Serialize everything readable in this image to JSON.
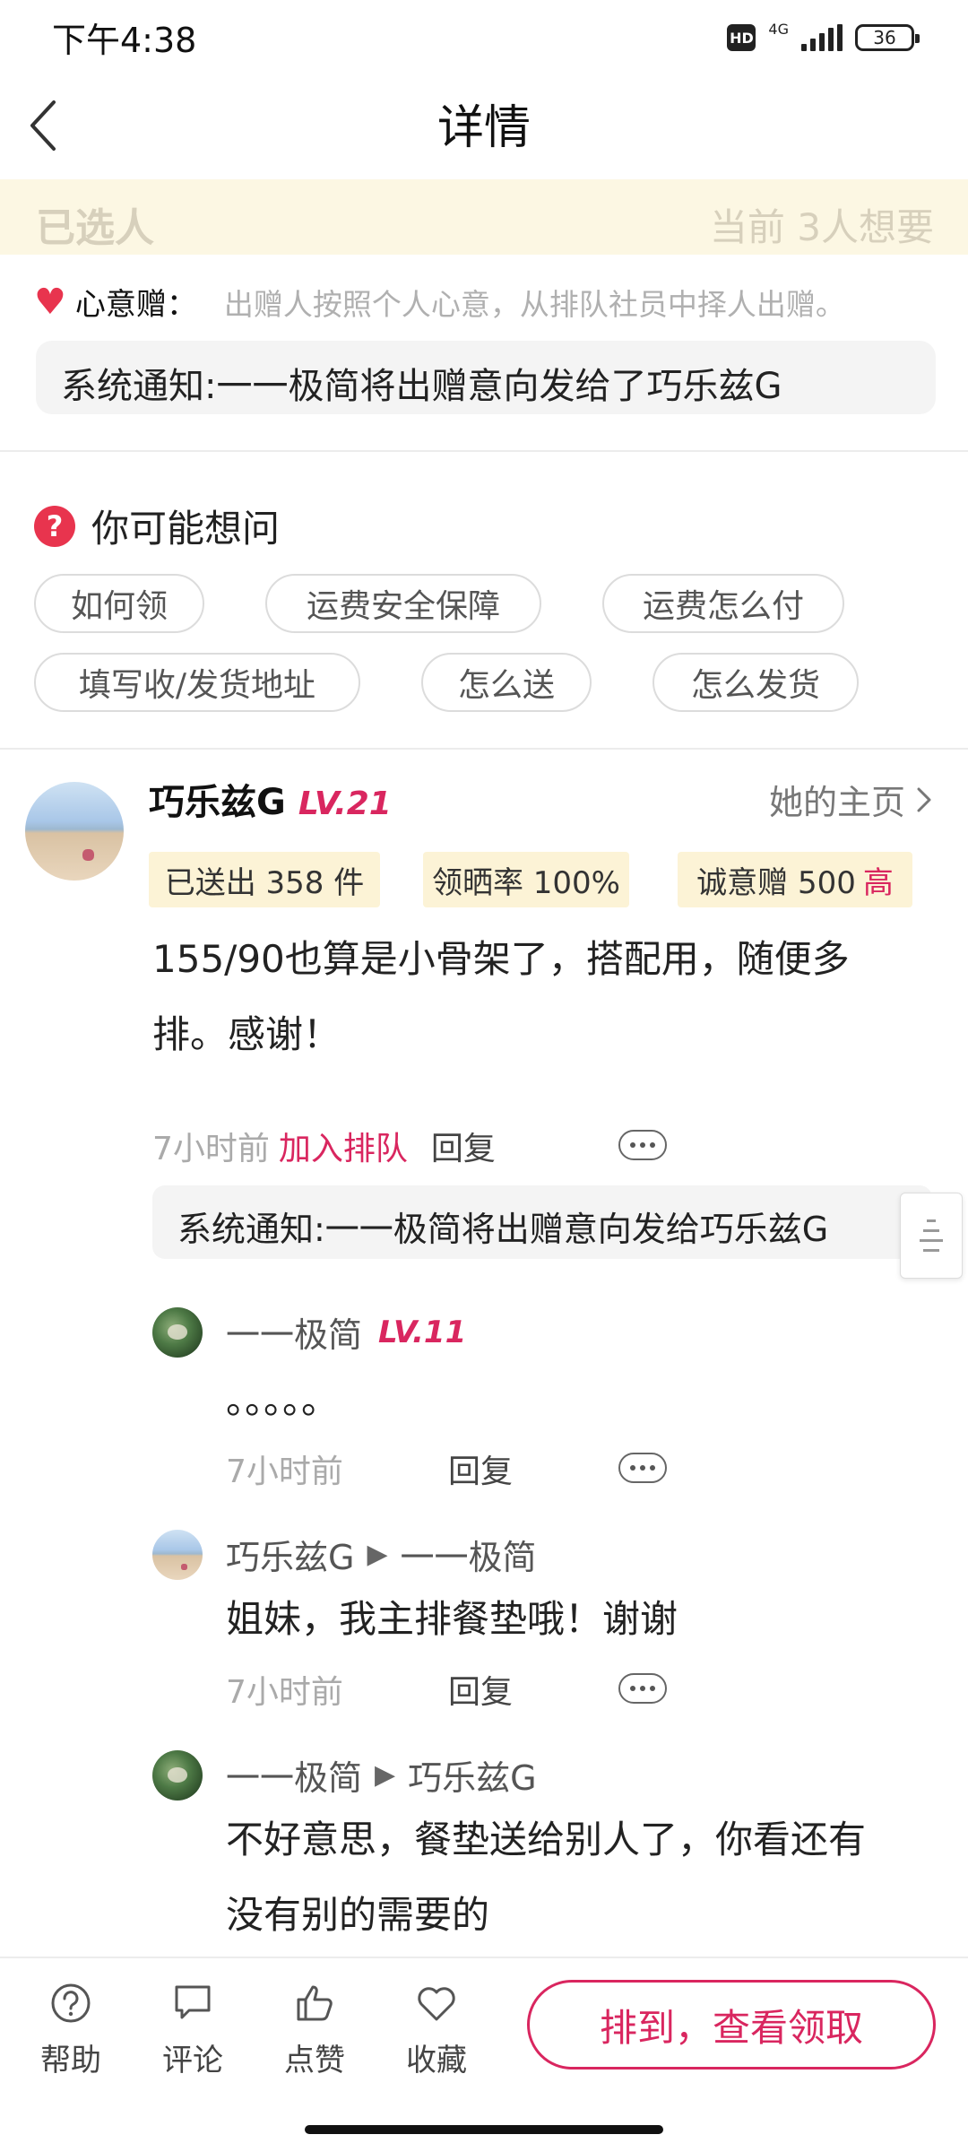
{
  "status_bar": {
    "time": "下午4:38",
    "hd": "HD",
    "network": "4G",
    "battery": "36"
  },
  "nav": {
    "title": "详情"
  },
  "selected_banner": {
    "left": "已选人",
    "right": "当前 3人想要"
  },
  "gift": {
    "label": "心意赠：",
    "description": "出赠人按照个人心意，从排队社员中择人出赠。"
  },
  "notice": {
    "text": "系统通知:一一极简将出赠意向发给了巧乐兹G"
  },
  "faq": {
    "title": "你可能想问",
    "chips": [
      "如何领",
      "运费安全保障",
      "运费怎么付",
      "填写收/发货地址",
      "怎么送",
      "怎么发货"
    ]
  },
  "post": {
    "username": "巧乐兹G",
    "level": "LV.21",
    "homepage_label": "她的主页",
    "stats": {
      "sent": "已送出 358 件",
      "rate": "领晒率 100%",
      "sincerity": "诚意赠 500",
      "sincerity_level": "高"
    },
    "text_line1": "155/90也算是小骨架了，搭配用，随便多",
    "text_line2": "排。感谢！",
    "time": "7小时前",
    "join_label": "加入排队",
    "reply_label": "回复",
    "system_notice": "系统通知:一一极简将出赠意向发给巧乐兹G"
  },
  "replies": [
    {
      "author": "一一极简",
      "level": "LV.11",
      "text": "。。。。。",
      "time": "7小时前",
      "reply_label": "回复"
    },
    {
      "author": "巧乐兹G",
      "target": "一一极简",
      "text": "姐妹，我主排餐垫哦！谢谢",
      "time": "7小时前",
      "reply_label": "回复"
    },
    {
      "author": "一一极简",
      "target": "巧乐兹G",
      "text_line1": "不好意思，餐垫送给别人了，你看还有",
      "text_line2": "没有别的需要的"
    }
  ],
  "bottom_bar": {
    "help": "帮助",
    "comment": "评论",
    "like": "点赞",
    "favorite": "收藏",
    "cta": "排到，查看领取"
  },
  "colors": {
    "accent": "#d9265f",
    "banner_bg": "#fcf7e3",
    "tag_bg": "#fcf3d6"
  }
}
